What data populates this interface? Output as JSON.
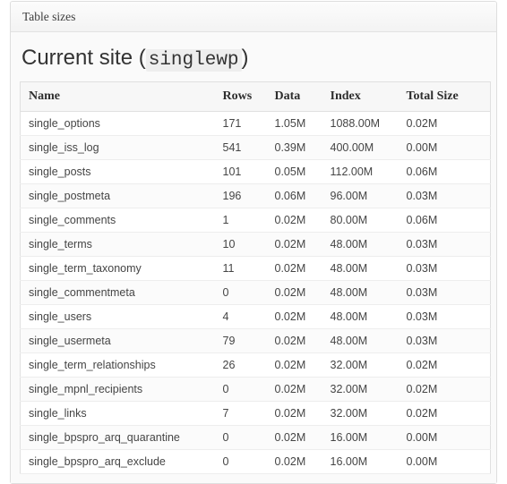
{
  "panel": {
    "header_title": "Table sizes"
  },
  "page": {
    "title_prefix": "Current site",
    "paren_open": "(",
    "site_slug": "singlewp",
    "paren_close": ")"
  },
  "table": {
    "columns": [
      {
        "key": "name",
        "label": "Name"
      },
      {
        "key": "rows",
        "label": "Rows"
      },
      {
        "key": "data",
        "label": "Data"
      },
      {
        "key": "index",
        "label": "Index"
      },
      {
        "key": "total",
        "label": "Total Size"
      }
    ],
    "rows": [
      {
        "name": "single_options",
        "rows": "171",
        "data": "1.05M",
        "index": "1088.00M",
        "total": "0.02M"
      },
      {
        "name": "single_iss_log",
        "rows": "541",
        "data": "0.39M",
        "index": "400.00M",
        "total": "0.00M"
      },
      {
        "name": "single_posts",
        "rows": "101",
        "data": "0.05M",
        "index": "112.00M",
        "total": "0.06M"
      },
      {
        "name": "single_postmeta",
        "rows": "196",
        "data": "0.06M",
        "index": "96.00M",
        "total": "0.03M"
      },
      {
        "name": "single_comments",
        "rows": "1",
        "data": "0.02M",
        "index": "80.00M",
        "total": "0.06M"
      },
      {
        "name": "single_terms",
        "rows": "10",
        "data": "0.02M",
        "index": "48.00M",
        "total": "0.03M"
      },
      {
        "name": "single_term_taxonomy",
        "rows": "11",
        "data": "0.02M",
        "index": "48.00M",
        "total": "0.03M"
      },
      {
        "name": "single_commentmeta",
        "rows": "0",
        "data": "0.02M",
        "index": "48.00M",
        "total": "0.03M"
      },
      {
        "name": "single_users",
        "rows": "4",
        "data": "0.02M",
        "index": "48.00M",
        "total": "0.03M"
      },
      {
        "name": "single_usermeta",
        "rows": "79",
        "data": "0.02M",
        "index": "48.00M",
        "total": "0.03M"
      },
      {
        "name": "single_term_relationships",
        "rows": "26",
        "data": "0.02M",
        "index": "32.00M",
        "total": "0.02M"
      },
      {
        "name": "single_mpnl_recipients",
        "rows": "0",
        "data": "0.02M",
        "index": "32.00M",
        "total": "0.02M"
      },
      {
        "name": "single_links",
        "rows": "7",
        "data": "0.02M",
        "index": "32.00M",
        "total": "0.02M"
      },
      {
        "name": "single_bpspro_arq_quarantine",
        "rows": "0",
        "data": "0.02M",
        "index": "16.00M",
        "total": "0.00M"
      },
      {
        "name": "single_bpspro_arq_exclude",
        "rows": "0",
        "data": "0.02M",
        "index": "16.00M",
        "total": "0.00M"
      }
    ]
  },
  "colors": {
    "panel_border": "#dedede",
    "panel_header_bg": "#f3f3f3",
    "panel_body_bg": "#fafafa",
    "table_border": "#e0e0e0",
    "row_separator": "#ededed",
    "text": "#454545",
    "heading": "#333333",
    "code_bg": "#eeeeee"
  }
}
